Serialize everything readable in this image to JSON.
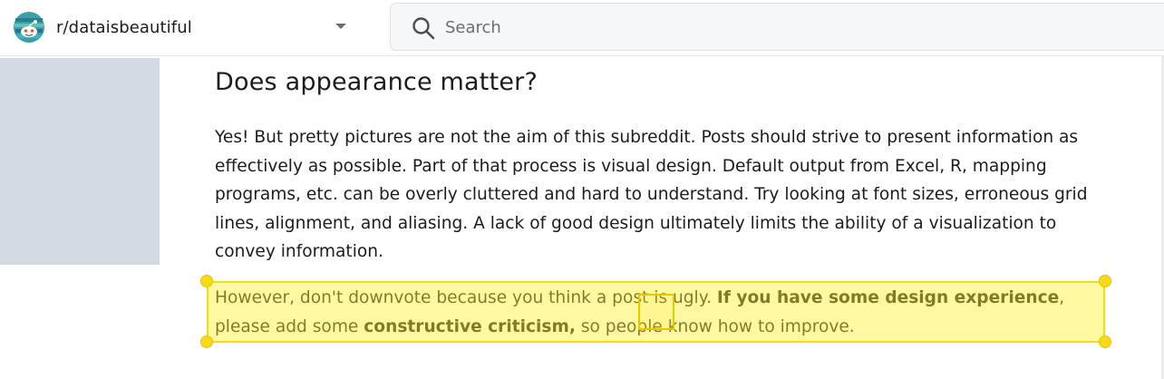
{
  "header": {
    "community_name": "r/dataisbeautiful",
    "search_placeholder": "Search"
  },
  "article": {
    "heading": "Does appearance matter?",
    "paragraph1": "Yes! But pretty pictures are not the aim of this subreddit. Posts should strive to present information as effectively as possible. Part of that process is visual design. Default output from Excel, R, mapping programs, etc. can be overly cluttered and hard to understand. Try looking at font sizes, erroneous grid lines, alignment, and aliasing. A lack of good design ultimately limits the ability of a visualization to convey information.",
    "paragraph2": {
      "part1": "However, don't downvote because you think a post is ugly. ",
      "bold1": "If you have some design experience",
      "part2": ", please add some ",
      "bold2": "constructive criticism,",
      "part3": " so people know how to improve."
    }
  },
  "colors": {
    "highlight": "#f5de10",
    "left_panel": "#d3dae3",
    "text": "#1c1c1c"
  }
}
